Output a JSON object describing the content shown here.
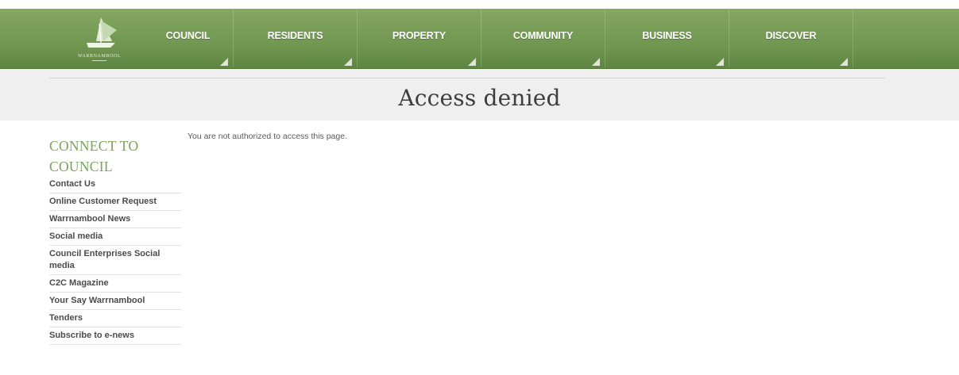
{
  "header": {
    "logo_text": "WARRNAMBOOL",
    "nav": [
      {
        "label": "COUNCIL"
      },
      {
        "label": "RESIDENTS"
      },
      {
        "label": "PROPERTY"
      },
      {
        "label": "COMMUNITY"
      },
      {
        "label": "BUSINESS"
      },
      {
        "label": "DISCOVER"
      }
    ]
  },
  "page": {
    "title": "Access denied",
    "message": "You are not authorized to access this page."
  },
  "sidebar": {
    "heading": "CONNECT TO COUNCIL",
    "items": [
      {
        "label": "Contact Us"
      },
      {
        "label": "Online Customer Request"
      },
      {
        "label": "Warrnambool News"
      },
      {
        "label": "Social media"
      },
      {
        "label": "Council Enterprises Social media"
      },
      {
        "label": "C2C Magazine"
      },
      {
        "label": "Your Say Warrnambool"
      },
      {
        "label": "Tenders"
      },
      {
        "label": "Subscribe to e-news"
      }
    ]
  },
  "colors": {
    "nav_green": "#6f9550",
    "sidebar_heading_green": "#7aa25a",
    "title_band": "#efefef"
  }
}
